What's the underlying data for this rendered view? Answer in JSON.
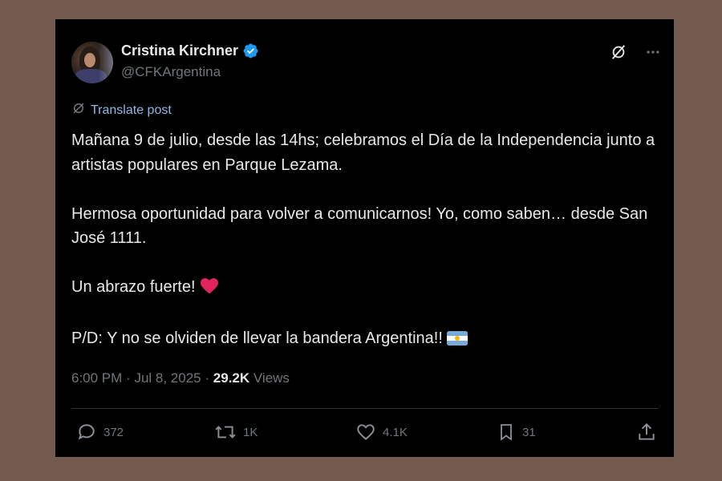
{
  "author": {
    "display_name": "Cristina Kirchner",
    "handle": "@CFKArgentina",
    "verified": true
  },
  "translate_label": "Translate post",
  "body": {
    "paragraph1": "Mañana 9 de julio, desde las 14hs; celebramos el Día de la Independencia junto a artistas populares en Parque Lezama.",
    "paragraph2": "Hermosa oportunidad para volver a comunicarnos! Yo, como saben… desde San José 1111.",
    "paragraph3": "Un abrazo fuerte!",
    "paragraph4": "P/D: Y no se olviden de llevar la bandera Argentina!!"
  },
  "meta": {
    "time": "6:00 PM",
    "separator": "·",
    "date": "Jul 8, 2025",
    "views_count": "29.2K",
    "views_label": "Views"
  },
  "actions": {
    "replies": "372",
    "reposts": "1K",
    "likes": "4.1K",
    "bookmarks": "31"
  },
  "colors": {
    "background": "#725a4e",
    "card": "#000000",
    "text": "#e7e9ea",
    "muted": "#71767b",
    "accent": "#1d9bf0",
    "heart": "#e0245e"
  },
  "icons": {
    "verified": "verified-badge-icon",
    "grok": "grok-icon",
    "more": "more-options-icon",
    "translate": "translate-icon",
    "reply": "reply-icon",
    "repost": "repost-icon",
    "like": "like-icon",
    "bookmark": "bookmark-icon",
    "share": "share-icon"
  }
}
